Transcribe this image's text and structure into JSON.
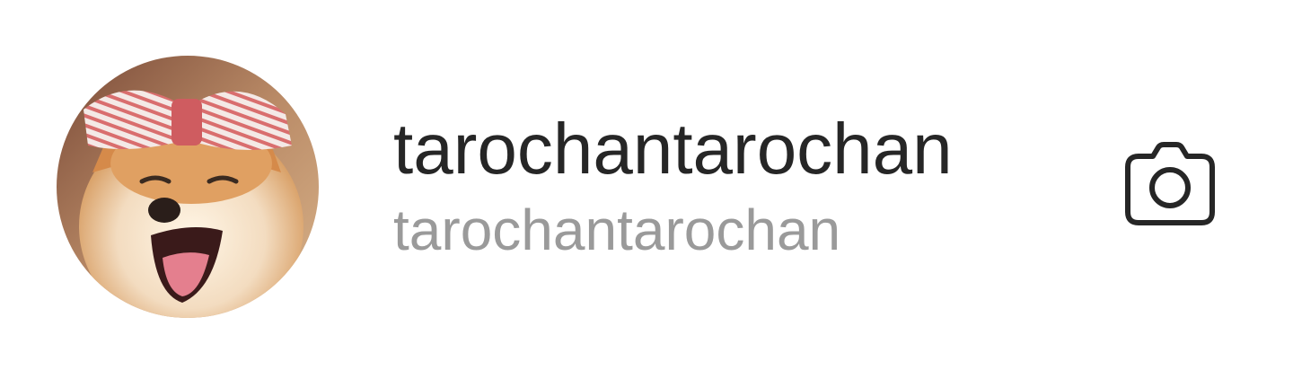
{
  "profile": {
    "display_name": "tarochantarochan",
    "username": "tarochantarochan",
    "avatar_icon": "shiba-dog-with-bow-photo"
  },
  "actions": {
    "camera_icon": "camera-icon"
  },
  "colors": {
    "primary_text": "#262626",
    "secondary_text": "#9a9a9a",
    "icon": "#262626",
    "background": "#ffffff"
  }
}
